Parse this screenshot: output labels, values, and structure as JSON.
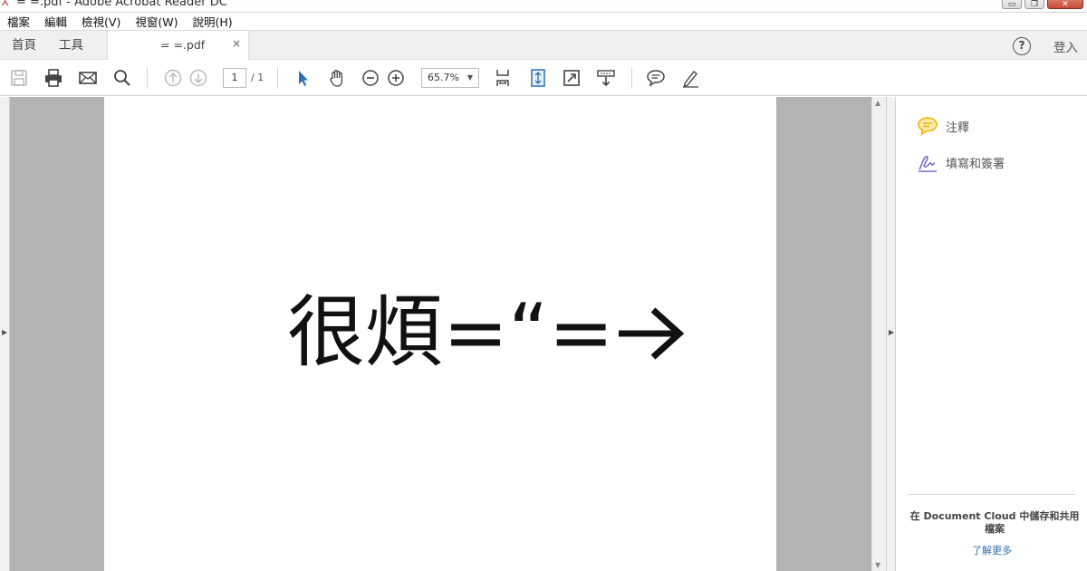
{
  "window": {
    "title": "= =.pdf - Adobe Acrobat Reader DC",
    "minimize_glyph": "▭",
    "restore_glyph": "❐",
    "close_glyph": "✕"
  },
  "menu": [
    "檔案",
    "編輯",
    "檢視(V)",
    "視窗(W)",
    "說明(H)"
  ],
  "tabs": {
    "home": "首頁",
    "tools": "工具",
    "document": "= =.pdf",
    "close_glyph": "×"
  },
  "header_right": {
    "help": "?",
    "signin": "登入"
  },
  "toolbar": {
    "icons": [
      "save-icon",
      "print-icon",
      "email-icon",
      "search-icon",
      "prev-page-icon",
      "next-page-icon",
      "select-cursor-icon",
      "hand-tool-icon",
      "zoom-out-icon",
      "zoom-in-icon",
      "fit-page-icon",
      "scroll-mode-icon",
      "fullscreen-icon",
      "read-mode-icon",
      "comment-icon",
      "sign-icon"
    ],
    "page_current": "1",
    "page_total": "/ 1",
    "zoom": "65.7%"
  },
  "document": {
    "text": "很煩=“=",
    "arrow": "→"
  },
  "right_pane": {
    "items": [
      {
        "label": "注釋",
        "icon": "comment-bubble-icon",
        "color": "#f2b300"
      },
      {
        "label": "填寫和簽署",
        "icon": "fill-sign-icon",
        "color": "#7b6ccf"
      }
    ],
    "cloud_text": "在 Document Cloud 中儲存和共用檔案",
    "learn_more": "了解更多"
  },
  "colors": {
    "accent_blue": "#2d6fb3",
    "doc_background": "#b3b3b3",
    "title_icon_red": "#c1272d"
  }
}
